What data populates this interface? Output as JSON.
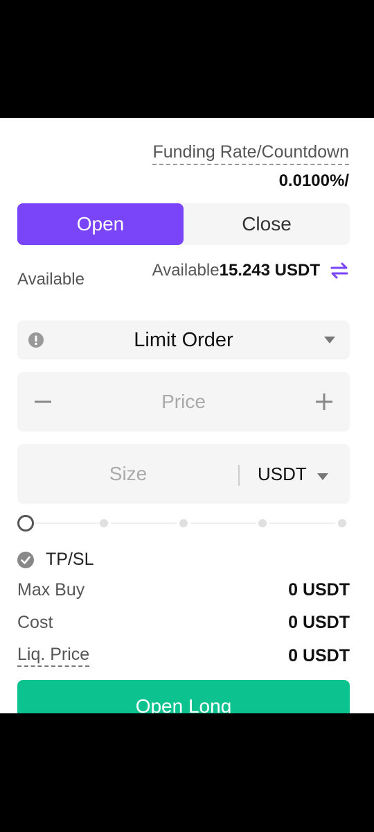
{
  "funding": {
    "label": "Funding Rate/Countdown",
    "value": "0.0100%/"
  },
  "tabs": [
    {
      "label": "Open",
      "active": true
    },
    {
      "label": "Close",
      "active": false
    }
  ],
  "available": {
    "left_label": "Available",
    "right_label": "Available",
    "amount": "15.243 USDT"
  },
  "order": {
    "type": "Limit Order"
  },
  "price": {
    "placeholder": "Price"
  },
  "size": {
    "placeholder": "Size",
    "unit": "USDT"
  },
  "slider": {
    "value_percent": 0,
    "marks": [
      0,
      25,
      50,
      75,
      100
    ]
  },
  "tpsl": {
    "label": "TP/SL",
    "checked": true
  },
  "stats": {
    "max_buy": {
      "label": "Max Buy",
      "value": "0 USDT"
    },
    "cost": {
      "label": "Cost",
      "value": "0 USDT"
    },
    "liq_price": {
      "label": "Liq. Price",
      "value": "0 USDT"
    }
  },
  "action": {
    "label": "Open Long"
  },
  "colors": {
    "accent": "#7a44f9",
    "long": "#0cc28f",
    "field_bg": "#f5f5f5"
  }
}
